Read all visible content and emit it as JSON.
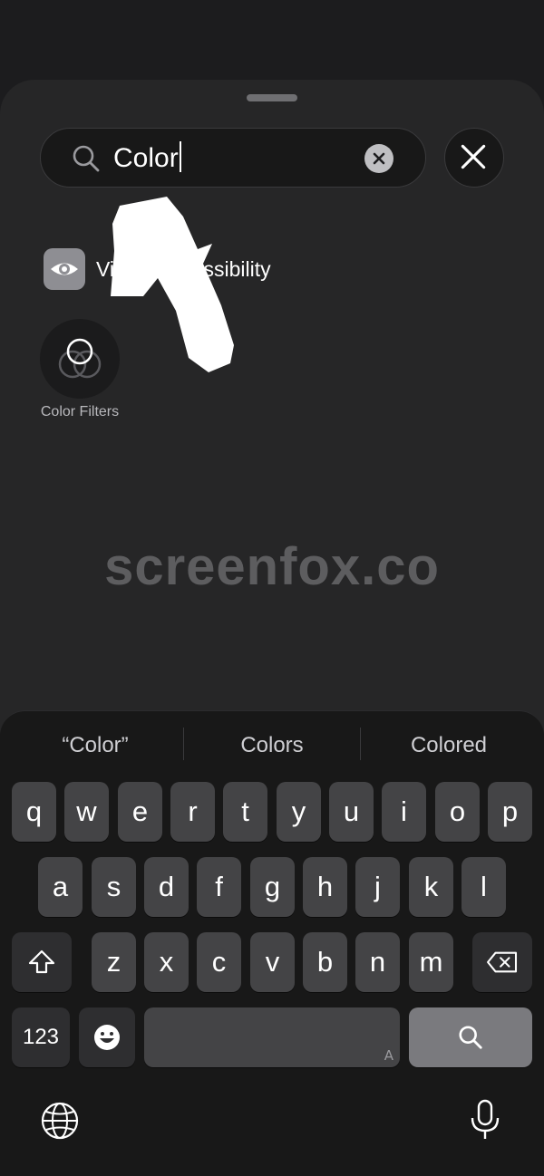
{
  "search": {
    "query": "Color"
  },
  "results": {
    "category_label": "Vision Accessibility",
    "tile_label": "Color Filters"
  },
  "watermark": "screenfox.co",
  "keyboard": {
    "suggestions": [
      "“Color”",
      "Colors",
      "Colored"
    ],
    "row1": [
      "q",
      "w",
      "e",
      "r",
      "t",
      "y",
      "u",
      "i",
      "o",
      "p"
    ],
    "row2": [
      "a",
      "s",
      "d",
      "f",
      "g",
      "h",
      "j",
      "k",
      "l"
    ],
    "row3": [
      "z",
      "x",
      "c",
      "v",
      "b",
      "n",
      "m"
    ],
    "numbers_label": "123",
    "space_hint": "A"
  },
  "colors": {
    "background": "#1c1c1e",
    "sheet": "#262627",
    "key": "#444446",
    "search_key": "#7a7a7e"
  }
}
